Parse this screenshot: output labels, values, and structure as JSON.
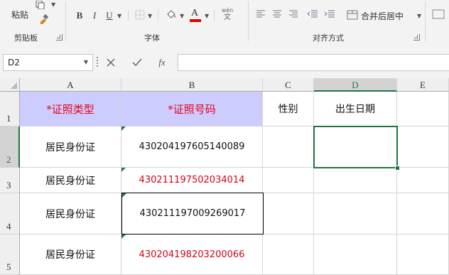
{
  "ribbon": {
    "clipboard": {
      "paste_label": "粘贴",
      "group_label": "剪贴板"
    },
    "font": {
      "bold_label": "B",
      "italic_label": "I",
      "underline_label": "U",
      "font_color_label": "A",
      "phonetic_label": "wén",
      "phonetic_sub": "文",
      "group_label": "字体",
      "font_color": "#e00000"
    },
    "alignment": {
      "merge_label": "合并后居中",
      "group_label": "对齐方式"
    }
  },
  "formula_bar": {
    "name_box": "D2",
    "cancel_icon": "close-icon",
    "enter_icon": "check-icon",
    "fx_label": "fx",
    "formula": ""
  },
  "sheet": {
    "columns": [
      "A",
      "B",
      "C",
      "D",
      "E"
    ],
    "selected_column": "D",
    "rows": [
      "1",
      "2",
      "3",
      "4",
      "5"
    ],
    "selected_row": "2",
    "header_row": {
      "a": "*证照类型",
      "b": "*证照号码",
      "c": "性别",
      "d": "出生日期"
    },
    "data_rows": [
      {
        "a": "居民身份证",
        "b": "430204197605140089",
        "b_red": false
      },
      {
        "a": "居民身份证",
        "b": "430211197502034014",
        "b_red": true
      },
      {
        "a": "居民身份证",
        "b": "430211197009269017",
        "b_red": false
      },
      {
        "a": "居民身份证",
        "b": "430204198203200066",
        "b_red": true
      }
    ],
    "header_fill": "#ccccff",
    "accent": "#217346"
  }
}
